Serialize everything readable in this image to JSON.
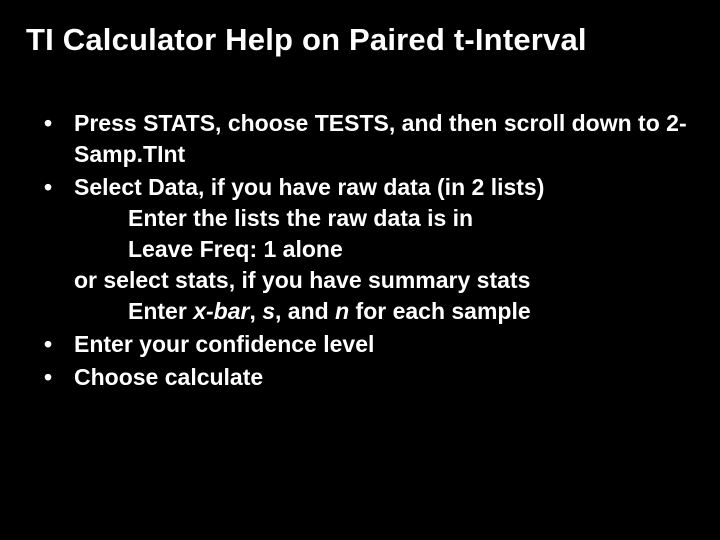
{
  "title": "TI Calculator Help on Paired t-Interval",
  "bullets": {
    "b1": {
      "p1": "Press ",
      "stats": "STATS",
      "p2": ", choose ",
      "tests": "TESTS",
      "p3": ", and then scroll down to ",
      "samp": "2-Samp.TInt"
    },
    "b2": {
      "line1": "Select Data, if you have raw data (in 2 lists)",
      "sub1": "Enter the lists the raw data is in",
      "sub2": "Leave Freq: 1 alone",
      "or": "or select stats, if you have summary stats",
      "sub3a": "Enter ",
      "xbar": "x-bar",
      "sub3b": ", ",
      "s": "s",
      "sub3c": ", and ",
      "n": "n",
      "sub3d": " for each sample"
    },
    "b3": "Enter your confidence level",
    "b4": "Choose calculate"
  }
}
